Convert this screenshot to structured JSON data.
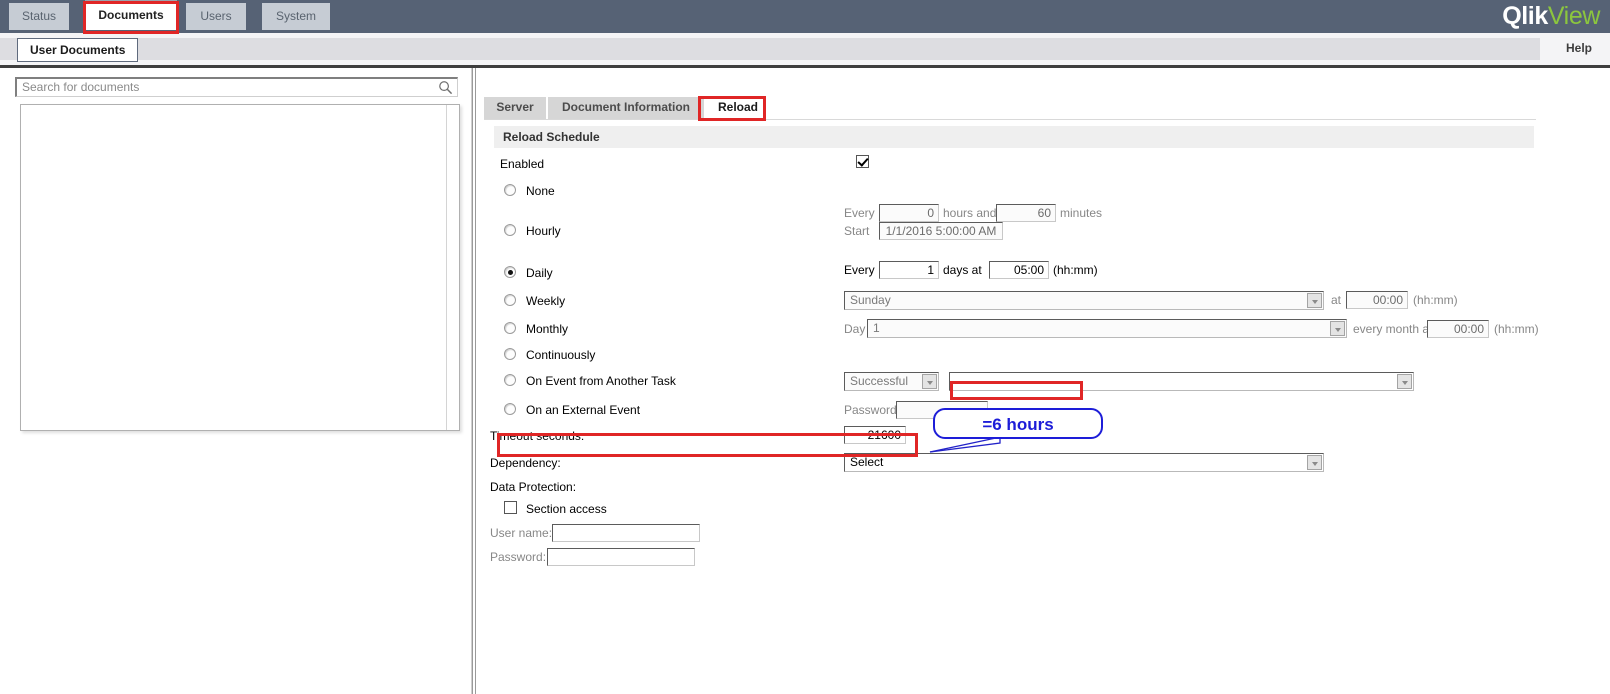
{
  "app": {
    "brand_primary": "Qlik",
    "brand_secondary": "View",
    "brand_color": "#ffffff",
    "brand_accent_color": "#8cc63e",
    "header_bg": "#566275"
  },
  "main_tabs": [
    {
      "label": "Status",
      "active": false
    },
    {
      "label": "Documents",
      "active": true
    },
    {
      "label": "Users",
      "active": false
    },
    {
      "label": "System",
      "active": false
    }
  ],
  "second_bar": {
    "section_tab": "User Documents",
    "help_label": "Help"
  },
  "sidebar": {
    "search_placeholder": "Search for documents",
    "search_value": "",
    "search_icon": "search-icon",
    "document_list_items": []
  },
  "sub_tabs": [
    {
      "label": "Server",
      "active": false
    },
    {
      "label": "Document Information",
      "active": false
    },
    {
      "label": "Reload",
      "active": true
    }
  ],
  "panel": {
    "title": "Reload Schedule",
    "enabled": {
      "label": "Enabled",
      "checked": true
    },
    "schedule_options": [
      {
        "id": "none",
        "label": "None",
        "selected": false
      },
      {
        "id": "hourly",
        "label": "Hourly",
        "selected": false
      },
      {
        "id": "daily",
        "label": "Daily",
        "selected": true
      },
      {
        "id": "weekly",
        "label": "Weekly",
        "selected": false
      },
      {
        "id": "monthly",
        "label": "Monthly",
        "selected": false
      },
      {
        "id": "continuously",
        "label": "Continuously",
        "selected": false
      },
      {
        "id": "on_event_task",
        "label": "On Event from Another Task",
        "selected": false
      },
      {
        "id": "on_external_event",
        "label": "On an External Event",
        "selected": false
      }
    ],
    "hourly": {
      "every_label": "Every",
      "hours_value": "0",
      "hours_label": "hours and",
      "minutes_value": "60",
      "minutes_label": "minutes",
      "start_label": "Start",
      "start_value": "1/1/2016 5:00:00 AM"
    },
    "daily": {
      "every_label": "Every",
      "days_value": "1",
      "days_label": "days at",
      "time_value": "05:00",
      "format_label": "(hh:mm)"
    },
    "weekly": {
      "day_value": "Sunday",
      "at_label": "at",
      "time_value": "00:00",
      "format_label": "(hh:mm)"
    },
    "monthly": {
      "day_label": "Day",
      "day_value": "1",
      "every_month_label": "every month at",
      "time_value": "00:00",
      "format_label": "(hh:mm)"
    },
    "on_event_task": {
      "status_value": "Successful",
      "task_value": ""
    },
    "on_external_event": {
      "password_label": "Password:",
      "password_value": ""
    },
    "timeout": {
      "label": "Timeout seconds:",
      "value": "21600"
    },
    "dependency": {
      "label": "Dependency:",
      "value": "Select"
    },
    "data_protection": {
      "label": "Data Protection:",
      "section_access_label": "Section access",
      "section_access_checked": false,
      "user_name_label": "User name:",
      "user_name_value": "",
      "password_label": "Password:",
      "password_value": ""
    }
  },
  "annotations": {
    "callout_text": "=6 hours",
    "callout_color": "#1d1dd8",
    "highlight_color": "#e02626",
    "highlighted_elements": [
      "main-tab-documents",
      "sub-tab-reload",
      "on-event-task-input",
      "timeout-row"
    ]
  }
}
